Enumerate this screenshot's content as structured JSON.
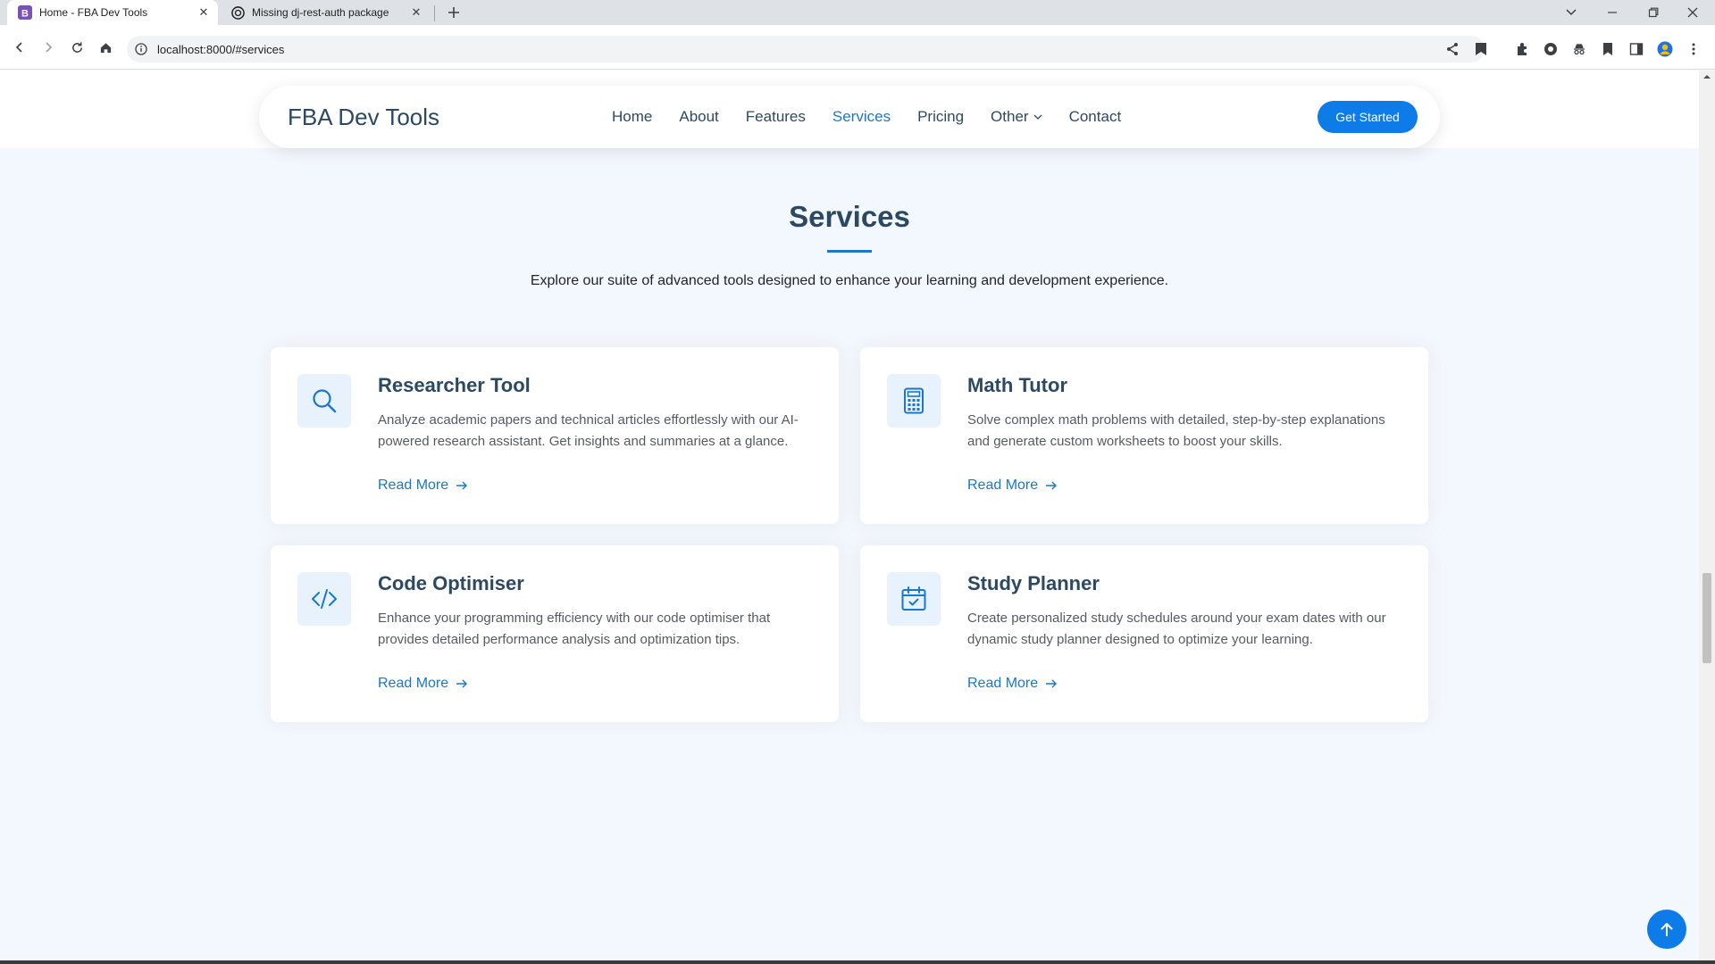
{
  "browser": {
    "tabs": [
      {
        "title": "Home - FBA Dev Tools",
        "favicon": "bootstrap-icon",
        "active": true
      },
      {
        "title": "Missing dj-rest-auth package",
        "favicon": "openai-icon",
        "active": false
      }
    ],
    "url": "localhost:8000/#services"
  },
  "nav": {
    "logo": "FBA Dev Tools",
    "links": [
      "Home",
      "About",
      "Features",
      "Services",
      "Pricing",
      "Other",
      "Contact"
    ],
    "active": "Services",
    "cta": "Get Started"
  },
  "section": {
    "title": "Services",
    "subtitle": "Explore our suite of advanced tools designed to enhance your learning and development experience."
  },
  "services": [
    {
      "icon": "search-icon",
      "title": "Researcher Tool",
      "description": "Analyze academic papers and technical articles effortlessly with our AI-powered research assistant. Get insights and summaries at a glance.",
      "link": "Read More"
    },
    {
      "icon": "calculator-icon",
      "title": "Math Tutor",
      "description": "Solve complex math problems with detailed, step-by-step explanations and generate custom worksheets to boost your skills.",
      "link": "Read More"
    },
    {
      "icon": "code-icon",
      "title": "Code Optimiser",
      "description": "Enhance your programming efficiency with our code optimiser that provides detailed performance analysis and optimization tips.",
      "link": "Read More"
    },
    {
      "icon": "calendar-check-icon",
      "title": "Study Planner",
      "description": "Create personalized study schedules around your exam dates with our dynamic study planner designed to optimize your learning.",
      "link": "Read More"
    }
  ],
  "colors": {
    "accent": "#1977cc",
    "button": "#0d7be8",
    "heading": "#2c4964",
    "page_bg": "#f3f8fe"
  }
}
